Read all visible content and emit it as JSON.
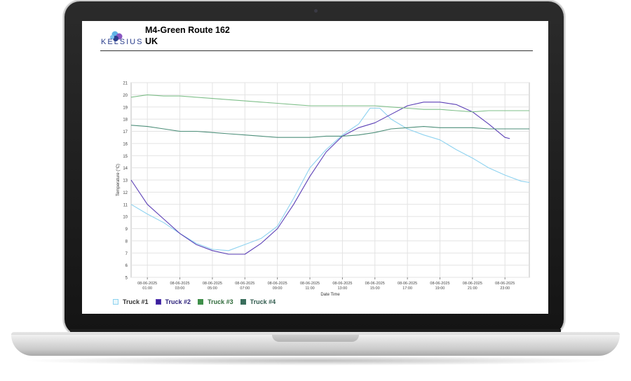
{
  "report": {
    "logo_text": "KELSIUS",
    "title": "M4-Green Route 162",
    "subtitle": "UK"
  },
  "chart_data": {
    "type": "line",
    "ylabel": "Temperature (°C)",
    "xlabel": "Date Time",
    "ylim": [
      5,
      21
    ],
    "xlim": [
      0,
      24.5
    ],
    "grid": true,
    "legend_position": "bottom-left",
    "x_ticks": [
      {
        "x": 1,
        "date": "08-06-2025",
        "time": "01:00"
      },
      {
        "x": 3,
        "date": "08-06-2025",
        "time": "03:00"
      },
      {
        "x": 5,
        "date": "08-06-2025",
        "time": "05:00"
      },
      {
        "x": 7,
        "date": "08-06-2025",
        "time": "07:00"
      },
      {
        "x": 9,
        "date": "08-06-2025",
        "time": "09:00"
      },
      {
        "x": 11,
        "date": "08-06-2025",
        "time": "11:00"
      },
      {
        "x": 13,
        "date": "08-06-2025",
        "time": "13:00"
      },
      {
        "x": 15,
        "date": "08-06-2025",
        "time": "15:00"
      },
      {
        "x": 17,
        "date": "08-06-2025",
        "time": "17:00"
      },
      {
        "x": 19,
        "date": "08-06-2025",
        "time": "19:00"
      },
      {
        "x": 21,
        "date": "08-06-2025",
        "time": "21:00"
      },
      {
        "x": 23,
        "date": "08-06-2025",
        "time": "23:00"
      }
    ],
    "y_ticks": [
      5,
      6,
      7,
      8,
      9,
      10,
      11,
      12,
      13,
      14,
      15,
      16,
      17,
      18,
      19,
      20,
      21
    ],
    "series": [
      {
        "name": "Truck #1",
        "color": "#8fd3f0",
        "points": [
          [
            0,
            11.0
          ],
          [
            1,
            10.2
          ],
          [
            2,
            9.5
          ],
          [
            3,
            8.6
          ],
          [
            4,
            7.8
          ],
          [
            5,
            7.3
          ],
          [
            6,
            7.2
          ],
          [
            7,
            7.7
          ],
          [
            8,
            8.2
          ],
          [
            9,
            9.2
          ],
          [
            10,
            11.5
          ],
          [
            11,
            14.0
          ],
          [
            12,
            15.5
          ],
          [
            13,
            16.7
          ],
          [
            14,
            17.6
          ],
          [
            14.7,
            18.9
          ],
          [
            15.3,
            18.9
          ],
          [
            16,
            18.0
          ],
          [
            17,
            17.2
          ],
          [
            18,
            16.7
          ],
          [
            19,
            16.3
          ],
          [
            20,
            15.5
          ],
          [
            21,
            14.8
          ],
          [
            22,
            14.0
          ],
          [
            23,
            13.4
          ],
          [
            24,
            12.9
          ],
          [
            24.5,
            12.8
          ]
        ]
      },
      {
        "name": "Truck #2",
        "color": "#5b3fb6",
        "points": [
          [
            0,
            13.0
          ],
          [
            1,
            11.0
          ],
          [
            2,
            9.8
          ],
          [
            3,
            8.6
          ],
          [
            4,
            7.7
          ],
          [
            5,
            7.2
          ],
          [
            6,
            6.9
          ],
          [
            7,
            6.9
          ],
          [
            8,
            7.8
          ],
          [
            9,
            9.0
          ],
          [
            10,
            11.0
          ],
          [
            11,
            13.3
          ],
          [
            12,
            15.3
          ],
          [
            13,
            16.6
          ],
          [
            14,
            17.3
          ],
          [
            15,
            17.7
          ],
          [
            16,
            18.4
          ],
          [
            17,
            19.1
          ],
          [
            18,
            19.4
          ],
          [
            19,
            19.4
          ],
          [
            20,
            19.2
          ],
          [
            21,
            18.6
          ],
          [
            22,
            17.6
          ],
          [
            23,
            16.5
          ],
          [
            23.3,
            16.4
          ]
        ]
      },
      {
        "name": "Truck #3",
        "color": "#7fbf8a",
        "points": [
          [
            0,
            19.8
          ],
          [
            1,
            20.0
          ],
          [
            2,
            19.9
          ],
          [
            3,
            19.9
          ],
          [
            4,
            19.8
          ],
          [
            5,
            19.7
          ],
          [
            6,
            19.6
          ],
          [
            7,
            19.5
          ],
          [
            8,
            19.4
          ],
          [
            9,
            19.3
          ],
          [
            10,
            19.2
          ],
          [
            11,
            19.1
          ],
          [
            12,
            19.1
          ],
          [
            13,
            19.1
          ],
          [
            14,
            19.1
          ],
          [
            15,
            19.1
          ],
          [
            16,
            19.0
          ],
          [
            17,
            18.9
          ],
          [
            18,
            18.8
          ],
          [
            19,
            18.8
          ],
          [
            20,
            18.7
          ],
          [
            21,
            18.6
          ],
          [
            22,
            18.7
          ],
          [
            23,
            18.7
          ],
          [
            24,
            18.7
          ],
          [
            24.5,
            18.7
          ]
        ]
      },
      {
        "name": "Truck #4",
        "color": "#4e8f7a",
        "points": [
          [
            0,
            17.5
          ],
          [
            1,
            17.4
          ],
          [
            2,
            17.2
          ],
          [
            3,
            17.0
          ],
          [
            4,
            17.0
          ],
          [
            5,
            16.9
          ],
          [
            6,
            16.8
          ],
          [
            7,
            16.7
          ],
          [
            8,
            16.6
          ],
          [
            9,
            16.5
          ],
          [
            10,
            16.5
          ],
          [
            11,
            16.5
          ],
          [
            12,
            16.6
          ],
          [
            13,
            16.6
          ],
          [
            14,
            16.7
          ],
          [
            15,
            16.9
          ],
          [
            16,
            17.2
          ],
          [
            17,
            17.3
          ],
          [
            18,
            17.4
          ],
          [
            19,
            17.3
          ],
          [
            20,
            17.3
          ],
          [
            21,
            17.3
          ],
          [
            22,
            17.2
          ],
          [
            23,
            17.2
          ],
          [
            24,
            17.2
          ],
          [
            24.5,
            17.2
          ]
        ]
      }
    ]
  }
}
